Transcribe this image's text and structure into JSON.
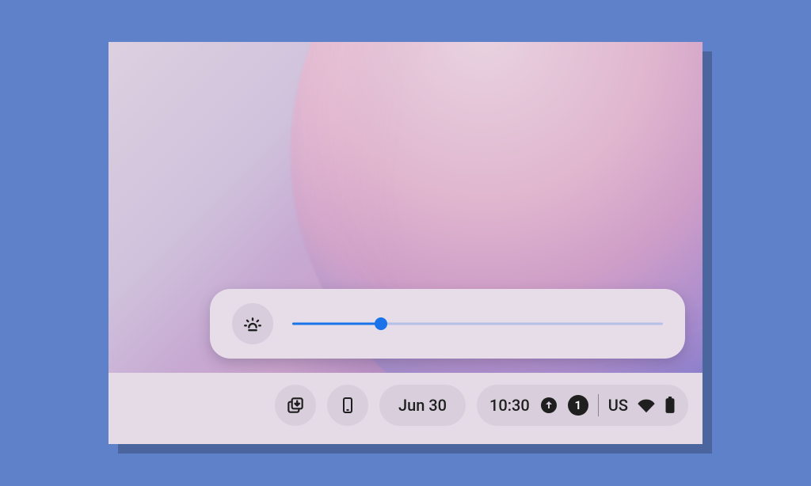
{
  "brightness": {
    "value": 24,
    "min": 0,
    "max": 100
  },
  "shelf": {
    "date": "Jun 30",
    "time": "10:30",
    "notification_count": "1",
    "keyboard_layout": "US"
  },
  "colors": {
    "accent": "#1a73e8"
  }
}
